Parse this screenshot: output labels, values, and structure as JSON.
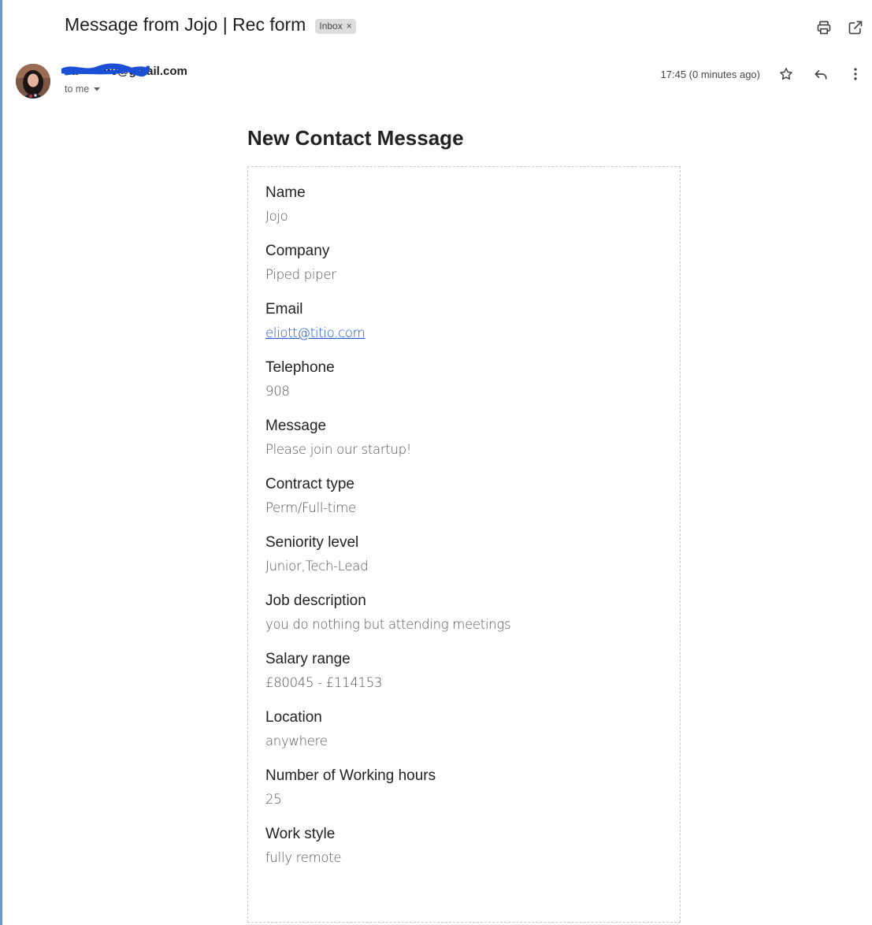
{
  "header": {
    "subject": "Message from Jojo | Rec form",
    "label": "Inbox",
    "label_remove": "×"
  },
  "actions": {
    "print_icon": "print-icon",
    "open_new_window_icon": "open-in-new-window-icon",
    "star_icon": "star-icon",
    "reply_icon": "reply-icon",
    "more_icon": "more-vertical-icon"
  },
  "sender": {
    "email": "ca••••••••0@gmail.com",
    "recipient": "to me",
    "timestamp": "17:45 (0 minutes ago)"
  },
  "body": {
    "title": "New Contact Message",
    "fields": [
      {
        "label": "Name",
        "value": "Jojo"
      },
      {
        "label": "Company",
        "value": "Piped piper"
      },
      {
        "label": "Email",
        "value": "eliott@titio.com"
      },
      {
        "label": "Telephone",
        "value": "908"
      },
      {
        "label": "Message",
        "value": "Please join our startup!"
      },
      {
        "label": "Contract type",
        "value": "Perm/Full-time"
      },
      {
        "label": "Seniority level",
        "value": "Junior,Tech-Lead"
      },
      {
        "label": "Job description",
        "value": "you do nothing but attending meetings"
      },
      {
        "label": "Salary range",
        "value": "£80045 - £114153"
      },
      {
        "label": "Location",
        "value": "anywhere"
      },
      {
        "label": "Number of Working hours",
        "value": "25"
      },
      {
        "label": "Work style",
        "value": "fully remote"
      }
    ]
  },
  "colors": {
    "link": "#1a55d6",
    "redaction": "#1a4fd6",
    "left_edge": "#6a9bd3"
  }
}
